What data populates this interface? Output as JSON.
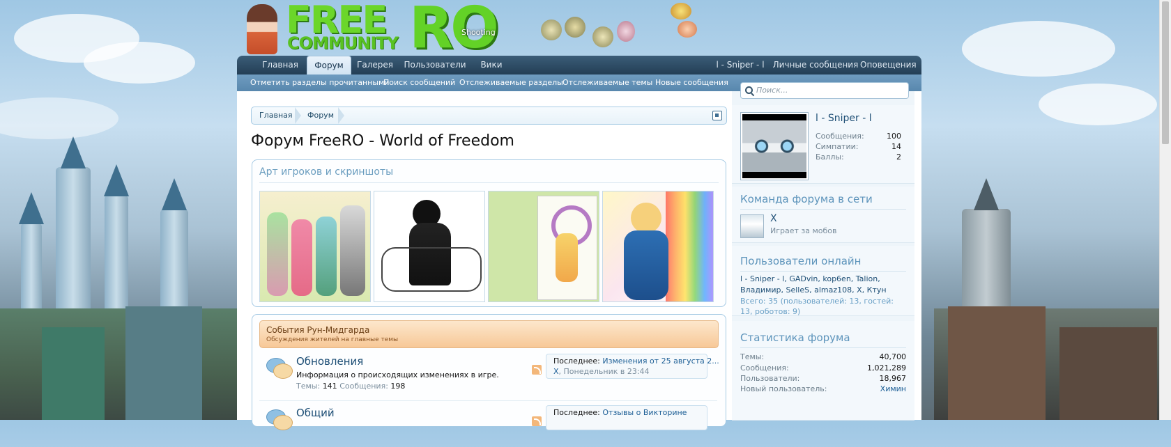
{
  "header": {
    "logo_free": "FREE",
    "logo_community": "COMMUNITY",
    "logo_ro": "RO",
    "logo_shooting": "Shooting"
  },
  "nav": {
    "tabs": [
      "Главная",
      "Форум",
      "Галерея",
      "Пользователи",
      "Вики"
    ],
    "active_tab": "Форум",
    "right": [
      "l - Sniper - l",
      "Личные сообщения",
      "Оповещения"
    ]
  },
  "subnav": [
    "Отметить разделы прочитанными",
    "Поиск сообщений",
    "Отслеживаемые разделы",
    "Отслеживаемые темы",
    "Новые сообщения"
  ],
  "search": {
    "placeholder": "Поиск..."
  },
  "breadcrumb": [
    "Главная",
    "Форум"
  ],
  "page_title": "Форум FreeRO - World of Freedom",
  "art": {
    "title": "Арт игроков и скриншоты",
    "thumb_count": 4
  },
  "category": {
    "title": "События Рун-Мидгарда",
    "description": "Обсуждения жителей на главные темы"
  },
  "nodes": [
    {
      "title": "Обновления",
      "description": "Информация о происходящих изменениях в игре.",
      "threads_label": "Темы:",
      "threads": "141",
      "messages_label": "Сообщения:",
      "messages": "198",
      "last_label": "Последнее:",
      "last_title": "Изменения от 25 августа 2...",
      "last_user": "X",
      "last_time": ", Понедельник в 23:44"
    },
    {
      "title": "Общий",
      "last_label": "Последнее:",
      "last_title": "Отзывы о Викторине"
    }
  ],
  "profile": {
    "username": "l - Sniper - l",
    "stats": [
      {
        "label": "Сообщения:",
        "value": "100"
      },
      {
        "label": "Симпатии:",
        "value": "14"
      },
      {
        "label": "Баллы:",
        "value": "2"
      }
    ]
  },
  "staff": {
    "title": "Команда форума в сети",
    "name": "X",
    "status": "Играет за мобов"
  },
  "online": {
    "title": "Пользователи онлайн",
    "users": "l - Sniper - l, GADvin, kop6en, Talion, Владимир, SelleS, almaz108, X, Ктун",
    "total": "Всего: 35 (пользователей: 13, гостей: 13, роботов: 9)"
  },
  "forum_stats": {
    "title": "Статистика форума",
    "rows": [
      {
        "label": "Темы:",
        "value": "40,700"
      },
      {
        "label": "Сообщения:",
        "value": "1,021,289"
      },
      {
        "label": "Пользователи:",
        "value": "18,967"
      },
      {
        "label": "Новый пользователь:",
        "value": "Химин"
      }
    ]
  },
  "colors": {
    "nav_bg": "#233e55",
    "subnav_bg": "#5887ad",
    "link": "#1d5f96",
    "category_bg": "#f7c897"
  }
}
